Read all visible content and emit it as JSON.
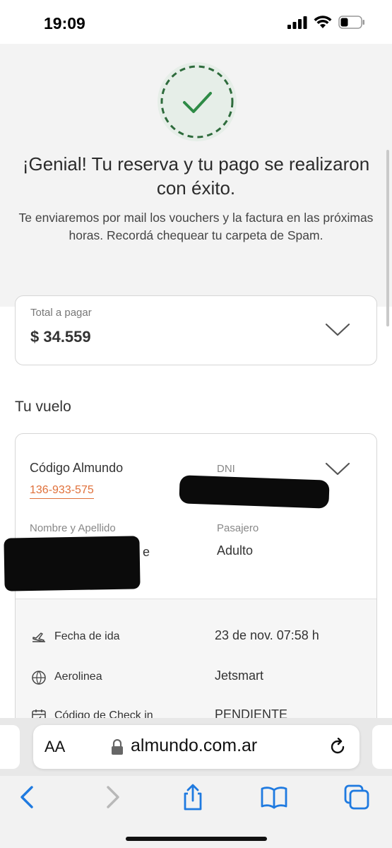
{
  "status_bar": {
    "time": "19:09"
  },
  "hero": {
    "title": "¡Genial! Tu reserva y tu pago se realizaron con éxito.",
    "subtitle": "Te enviaremos por mail los vouchers y la factura en las próximas horas. Recordá chequear tu carpeta de Spam.",
    "success_color": "#2e8b46"
  },
  "total": {
    "label": "Total a pagar",
    "value": "$ 34.559"
  },
  "flight_section": {
    "title": "Tu vuelo",
    "code_label": "Código Almundo",
    "code_value": "136-933-575",
    "dni_label": "DNI",
    "name_label": "Nombre y Apellido",
    "name_partial": "e",
    "passenger_label": "Pasajero",
    "passenger_value": "Adulto",
    "rows": [
      {
        "icon": "plane-takeoff-icon",
        "label": "Fecha de ida",
        "value": "23 de nov. 07:58 h"
      },
      {
        "icon": "airline-globe-icon",
        "label": "Aerolinea",
        "value": "Jetsmart"
      },
      {
        "icon": "calendar-check-icon",
        "label": "Código de Check in",
        "value": "PENDIENTE"
      }
    ]
  },
  "browser": {
    "aa_label": "AA",
    "url": "almundo.com.ar"
  },
  "accent_color": "#e0703a"
}
